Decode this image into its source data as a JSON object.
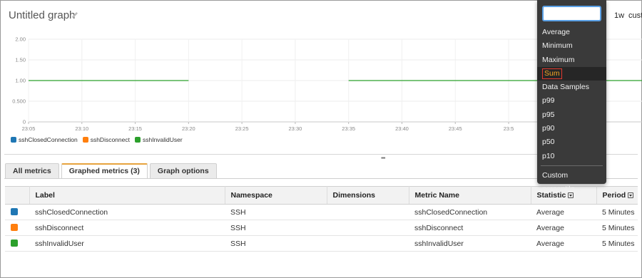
{
  "header": {
    "title": "Untitled graph",
    "range_buttons": [
      "1w",
      "cust"
    ]
  },
  "chart_data": {
    "type": "line",
    "ylim": [
      0,
      2
    ],
    "y_ticks": [
      "0",
      "0.500",
      "1.00",
      "1.50",
      "2.00"
    ],
    "x_ticks": [
      "23:05",
      "23:10",
      "23:15",
      "23:20",
      "23:25",
      "23:30",
      "23:35",
      "23:40",
      "23:45",
      "23:5"
    ],
    "x_tick_values": [
      5,
      10,
      15,
      20,
      25,
      30,
      35,
      40,
      45,
      50
    ],
    "xlim": [
      5,
      62.5
    ],
    "grid": true,
    "series": [
      {
        "name": "sshInvalidUser",
        "color": "#2ca02c",
        "segments": [
          [
            [
              5,
              1
            ],
            [
              20,
              1
            ]
          ],
          [
            [
              35,
              1
            ],
            [
              62.5,
              1
            ]
          ]
        ]
      }
    ]
  },
  "legend": [
    {
      "label": "sshClosedConnection",
      "color": "#1f77b4"
    },
    {
      "label": "sshDisconnect",
      "color": "#ff7f0e"
    },
    {
      "label": "sshInvalidUser",
      "color": "#2ca02c"
    }
  ],
  "tabs": [
    {
      "label": "All metrics",
      "active": false
    },
    {
      "label": "Graphed metrics (3)",
      "active": true
    },
    {
      "label": "Graph options",
      "active": false
    }
  ],
  "table": {
    "headers": [
      "Label",
      "Namespace",
      "Dimensions",
      "Metric Name",
      "Statistic",
      "Period"
    ],
    "rows": [
      {
        "color": "#1f77b4",
        "label": "sshClosedConnection",
        "namespace": "SSH",
        "dimensions": "",
        "metric": "sshClosedConnection",
        "statistic": "Average",
        "period": "5 Minutes"
      },
      {
        "color": "#ff7f0e",
        "label": "sshDisconnect",
        "namespace": "SSH",
        "dimensions": "",
        "metric": "sshDisconnect",
        "statistic": "Average",
        "period": "5 Minutes"
      },
      {
        "color": "#2ca02c",
        "label": "sshInvalidUser",
        "namespace": "SSH",
        "dimensions": "",
        "metric": "sshInvalidUser",
        "statistic": "Average",
        "period": "5 Minutes"
      }
    ]
  },
  "dropdown": {
    "input_value": "",
    "items": [
      "Average",
      "Minimum",
      "Maximum",
      "Sum",
      "Data Samples",
      "p99",
      "p95",
      "p90",
      "p50",
      "p10"
    ],
    "highlighted": "Sum",
    "footer": "Custom percentile..."
  }
}
